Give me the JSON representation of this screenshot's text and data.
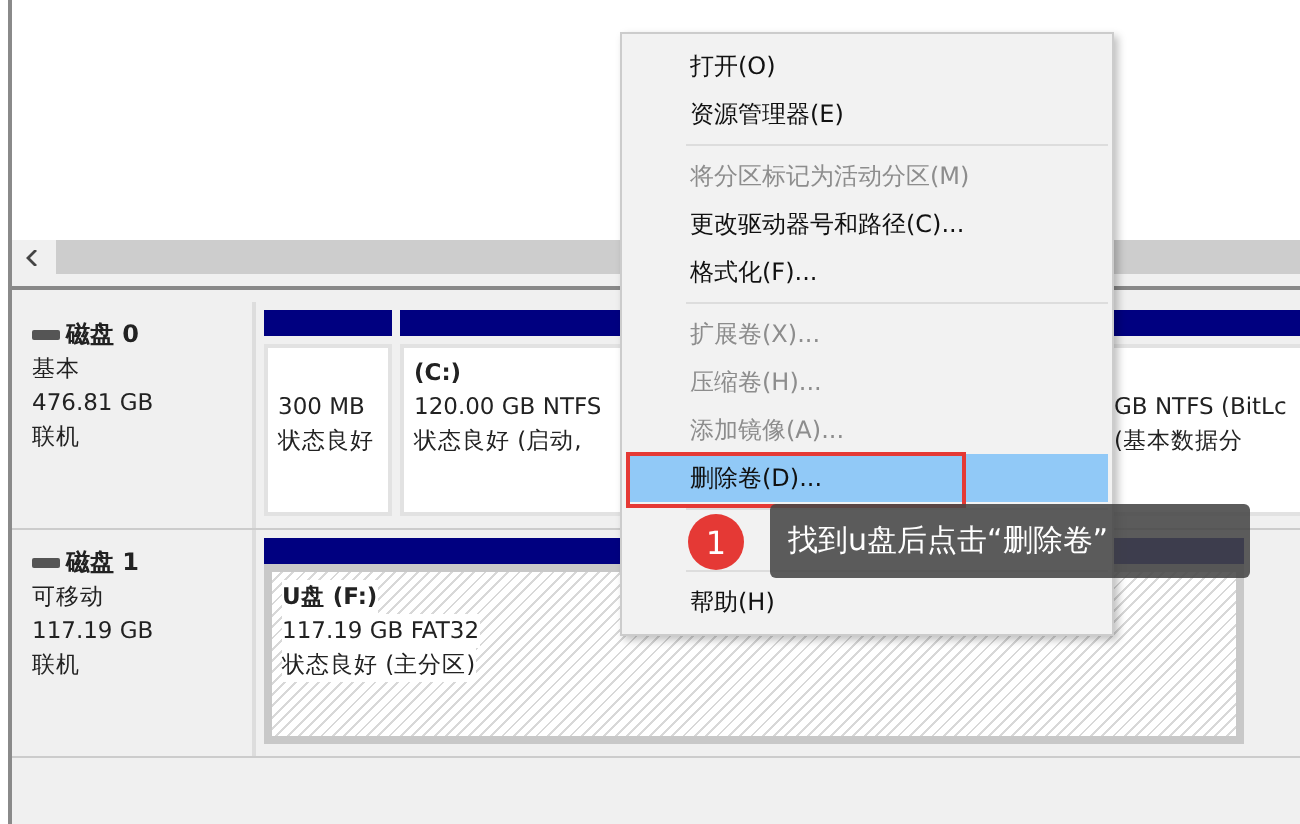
{
  "disks": [
    {
      "name": "磁盘 0",
      "type": "基本",
      "size": "476.81 GB",
      "status": "联机",
      "partitions": [
        {
          "selected": false,
          "lines": [
            "300 MB",
            "状态良好"
          ]
        },
        {
          "selected": false,
          "label": "(C:)",
          "lines": [
            "120.00 GB NTFS",
            "状态良好 (启动,"
          ]
        },
        {
          "selected": false,
          "lines": [
            "GB NTFS (BitLc",
            "(基本数据分"
          ]
        }
      ]
    },
    {
      "name": "磁盘 1",
      "type": "可移动",
      "size": "117.19 GB",
      "status": "联机",
      "partitions": [
        {
          "selected": true,
          "label": "U盘  (F:)",
          "lines": [
            "117.19 GB FAT32",
            "状态良好 (主分区)"
          ]
        }
      ]
    }
  ],
  "context_menu": [
    {
      "kind": "item",
      "label": "打开(O)",
      "disabled": false,
      "highlighted": false
    },
    {
      "kind": "item",
      "label": "资源管理器(E)",
      "disabled": false,
      "highlighted": false
    },
    {
      "kind": "separator"
    },
    {
      "kind": "item",
      "label": "将分区标记为活动分区(M)",
      "disabled": true,
      "highlighted": false
    },
    {
      "kind": "item",
      "label": "更改驱动器号和路径(C)...",
      "disabled": false,
      "highlighted": false
    },
    {
      "kind": "item",
      "label": "格式化(F)...",
      "disabled": false,
      "highlighted": false
    },
    {
      "kind": "separator"
    },
    {
      "kind": "item",
      "label": "扩展卷(X)...",
      "disabled": true,
      "highlighted": false
    },
    {
      "kind": "item",
      "label": "压缩卷(H)...",
      "disabled": true,
      "highlighted": false
    },
    {
      "kind": "item",
      "label": "添加镜像(A)...",
      "disabled": true,
      "highlighted": false
    },
    {
      "kind": "item",
      "label": "删除卷(D)...",
      "disabled": false,
      "highlighted": true
    },
    {
      "kind": "separator"
    },
    {
      "kind": "covered"
    },
    {
      "kind": "separator"
    },
    {
      "kind": "item",
      "label": "帮助(H)",
      "disabled": false,
      "highlighted": false
    }
  ],
  "callout": {
    "step": "1",
    "text": "找到u盘后点击“删除卷”"
  }
}
